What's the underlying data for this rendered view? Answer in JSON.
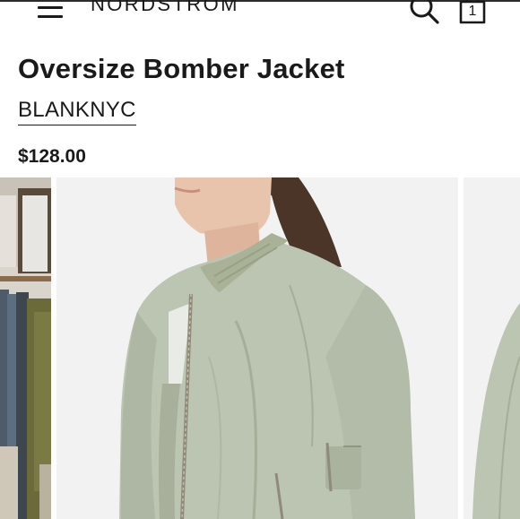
{
  "header": {
    "brand": "NORDSTROM",
    "menu_icon": "hamburger-menu-icon",
    "search_icon": "search-icon",
    "bag_icon": "shopping-bag-icon",
    "bag_count": "1"
  },
  "product": {
    "title": "Oversize Bomber Jacket",
    "designer": "BLANKNYC",
    "price": "$128.00"
  },
  "gallery": {
    "images": [
      {
        "name": "previous-image",
        "alt": "store rack with jackets"
      },
      {
        "name": "main-image",
        "alt": "model wearing sage green oversize bomber jacket"
      },
      {
        "name": "next-image",
        "alt": "jacket side view"
      }
    ]
  },
  "colors": {
    "jacket": "#bcc4b2",
    "jacket_shadow": "#9ea792",
    "background": "#f2f2f2",
    "text": "#1a1a1a"
  }
}
